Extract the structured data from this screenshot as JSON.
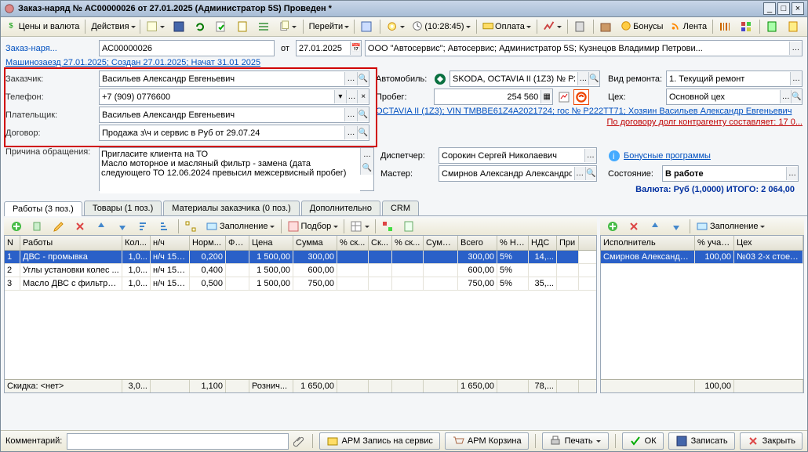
{
  "window": {
    "title": "Заказ-наряд № АС00000026 от 27.01.2025 (Администратор 5S) Проведен *"
  },
  "toolbar": {
    "prices": "Цены и валюта",
    "actions": "Действия",
    "goto": "Перейти",
    "clock": "(10:28:45)",
    "payment": "Оплата",
    "bonuses": "Бонусы",
    "feed": "Лента"
  },
  "head": {
    "doc_label": "Заказ-наря...",
    "doc_no": "АС00000026",
    "from": "от",
    "date": "27.01.2025",
    "org": "ООО \"Автосервис\"; Автосервис; Администратор 5S; Кузнецов Владимир Петрови...",
    "carline": "Машинозаезд 27.01.2025; Создан 27.01.2025; Начат 31.01 2025"
  },
  "labels": {
    "customer": "Заказчик:",
    "phone": "Телефон:",
    "payer": "Плательщик:",
    "contract": "Договор:",
    "car": "Автомобиль:",
    "mileage": "Пробег:",
    "type": "Вид ремонта:",
    "shop": "Цех:",
    "reason": "Причина обращения:",
    "dispatcher": "Диспетчер:",
    "master": "Мастер:",
    "status": "Состояние:",
    "comment": "Комментарий:"
  },
  "fields": {
    "customer": "Васильев Александр Евгеньевич",
    "phone": "+7 (909) 0776600",
    "payer": "Васильев Александр Евгеньевич",
    "contract": "Продажа з\\ч и сервис в Руб от 29.07.24",
    "car": "SKODA, OCTAVIA II (1Z3) № Р222...",
    "mileage": "254 560",
    "type": "1. Текущий ремонт",
    "shop": "Основной цех",
    "reason": "Пригласите клиента на ТО\nМасло моторное и масляный фильтр - замена (дата следующего ТО 12.06.2024 превысил межсервисный пробег)",
    "dispatcher": "Сорокин Сергей Николаевич",
    "master": "Смирнов Александр Александрович",
    "status": "В работе"
  },
  "links": {
    "carinfo": "OCTAVIA II (1Z3); VIN TMBBE61Z4A2021724; гос № Р222ТТ71; Хозяин Васильев Александр Евгеньевич",
    "debt": "По договору долг контрагенту составляет: 17 0...",
    "bonus": "Бонусные программы"
  },
  "totals": "Валюта: Руб (1,0000) ИТОГО: 2 064,00",
  "tabs": {
    "works": "Работы (3 поз.)",
    "goods": "Товары (1 поз.)",
    "mats": "Материалы заказчика (0 поз.)",
    "extra": "Дополнительно",
    "crm": "CRM"
  },
  "innerbar": {
    "fill": "Заполнение",
    "select": "Подбор"
  },
  "grid1": {
    "cols": {
      "n": "N",
      "name": "Работы",
      "qty": "Кол...",
      "unit": "н/ч",
      "norm": "Норм...",
      "fix": "Фи...",
      "price": "Цена",
      "sum": "Сумма",
      "d1": "% ск...",
      "d2": "Ск...",
      "d3": "% ск...",
      "d4": "Сумм...",
      "total": "Всего",
      "vat": "% НДС",
      "vatv": "НДС",
      "note": "При"
    },
    "rows": [
      {
        "n": "1",
        "name": "ДВС - промывка",
        "qty": "1,0...",
        "unit": "н/ч 150...",
        "norm": "0,200",
        "fix": "",
        "price": "1 500,00",
        "sum": "300,00",
        "total": "300,00",
        "vat": "5%",
        "vatv": "14,..."
      },
      {
        "n": "2",
        "name": "Углы установки колес ...",
        "qty": "1,0...",
        "unit": "н/ч 150...",
        "norm": "0,400",
        "fix": "",
        "price": "1 500,00",
        "sum": "600,00",
        "total": "600,00",
        "vat": "5%",
        "vatv": ""
      },
      {
        "n": "3",
        "name": "Масло ДВС с фильтро...",
        "qty": "1,0...",
        "unit": "н/ч 150...",
        "norm": "0,500",
        "fix": "",
        "price": "1 500,00",
        "sum": "750,00",
        "total": "750,00",
        "vat": "5%",
        "vatv": "35,..."
      }
    ],
    "footer": {
      "discount": "Скидка: <нет>",
      "qty": "3,0...",
      "norm": "1,100",
      "price": "Рознич...",
      "sum": "1 650,00",
      "total": "1 650,00",
      "vatv": "78,..."
    }
  },
  "grid2": {
    "cols": {
      "exec": "Исполнитель",
      "pct": "% учас...",
      "shop": "Цех"
    },
    "rows": [
      {
        "exec": "Смирнов Александр...",
        "pct": "100,00",
        "shop": "№03  2-х стоечн..."
      }
    ],
    "footer": {
      "pct": "100,00"
    }
  },
  "footerbar": {
    "arm_rec": "АРМ Запись на сервис",
    "arm_cart": "АРМ Корзина",
    "print": "Печать",
    "ok": "ОК",
    "save": "Записать",
    "close": "Закрыть"
  },
  "innerbar2": {
    "fill": "Заполнение"
  }
}
